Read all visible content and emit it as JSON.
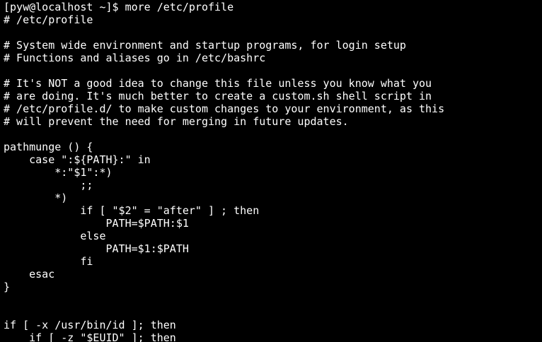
{
  "terminal": {
    "background": "#000000",
    "foreground": "#ffffff",
    "lines": [
      "[pyw@localhost ~]$ more /etc/profile",
      "# /etc/profile",
      "",
      "# System wide environment and startup programs, for login setup",
      "# Functions and aliases go in /etc/bashrc",
      "",
      "# It's NOT a good idea to change this file unless you know what you",
      "# are doing. It's much better to create a custom.sh shell script in",
      "# /etc/profile.d/ to make custom changes to your environment, as this",
      "# will prevent the need for merging in future updates.",
      "",
      "pathmunge () {",
      "    case \":${PATH}:\" in",
      "        *:\"$1\":*)",
      "            ;;",
      "        *)",
      "            if [ \"$2\" = \"after\" ] ; then",
      "                PATH=$PATH:$1",
      "            else",
      "                PATH=$1:$PATH",
      "            fi",
      "    esac",
      "}",
      "",
      "",
      "if [ -x /usr/bin/id ]; then",
      "    if [ -z \"$EUID\" ]; then"
    ]
  }
}
